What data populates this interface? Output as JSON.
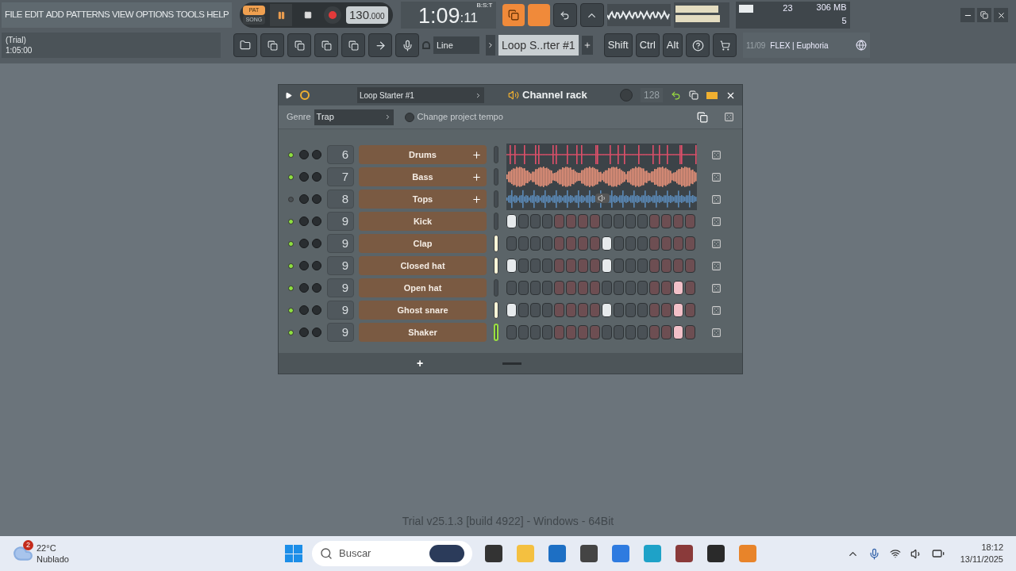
{
  "menu": [
    "FILE",
    "EDIT",
    "ADD",
    "PATTERNS",
    "VIEW",
    "OPTIONS",
    "TOOLS",
    "HELP"
  ],
  "transport": {
    "modes": [
      {
        "label": "PAT",
        "selected": true
      },
      {
        "label": "SONG",
        "selected": false
      }
    ],
    "tempo": "130",
    "tempo_fraction": ".000",
    "time": "1:09",
    "time_sub": ":11",
    "time_unit": "B:S:T"
  },
  "hint_panel": {
    "line_1": "(Trial)",
    "line_2": "1:05:00"
  },
  "snap": "Line",
  "pattern": "Loop S..rter #1",
  "modifier_keys": [
    "Shift",
    "Ctrl",
    "Alt"
  ],
  "monitor": {
    "cpu": "23",
    "memory": "306 MB",
    "polyphony": "5"
  },
  "news": {
    "date": "11/09",
    "text": "FLEX | Euphoria"
  },
  "channel_rack": {
    "loop": "Loop Starter #1",
    "title": "Channel rack",
    "swing": "128",
    "genre_label": "Genre",
    "genre": "Trap",
    "tempo_option": {
      "label": "Change project tempo",
      "checked": false
    },
    "channels": [
      {
        "kind": "audio",
        "number": "6",
        "name": "Drums",
        "active": true,
        "selected": false,
        "focused": false,
        "color": "#e0506a"
      },
      {
        "kind": "audio",
        "number": "7",
        "name": "Bass",
        "active": true,
        "selected": false,
        "focused": false,
        "color": "#e8927a"
      },
      {
        "kind": "audio",
        "number": "8",
        "name": "Tops",
        "active": false,
        "selected": false,
        "focused": false,
        "color": "#5b8ab8"
      },
      {
        "kind": "steps",
        "number": "9",
        "name": "Kick",
        "active": true,
        "selected": false,
        "focused": false,
        "steps": [
          true,
          false,
          false,
          false,
          false,
          false,
          false,
          false,
          false,
          false,
          false,
          false,
          false,
          false,
          false,
          false
        ]
      },
      {
        "kind": "steps",
        "number": "9",
        "name": "Clap",
        "active": true,
        "selected": true,
        "focused": false,
        "steps": [
          false,
          false,
          false,
          false,
          false,
          false,
          false,
          false,
          true,
          false,
          false,
          false,
          false,
          false,
          false,
          false
        ]
      },
      {
        "kind": "steps",
        "number": "9",
        "name": "Closed hat",
        "active": true,
        "selected": true,
        "focused": false,
        "steps": [
          true,
          false,
          false,
          false,
          false,
          false,
          false,
          false,
          true,
          false,
          false,
          false,
          false,
          false,
          false,
          false
        ]
      },
      {
        "kind": "steps",
        "number": "9",
        "name": "Open hat",
        "active": true,
        "selected": false,
        "focused": false,
        "steps": [
          false,
          false,
          false,
          false,
          false,
          false,
          false,
          false,
          false,
          false,
          false,
          false,
          false,
          false,
          true,
          false
        ]
      },
      {
        "kind": "steps",
        "number": "9",
        "name": "Ghost snare",
        "active": true,
        "selected": true,
        "focused": false,
        "steps": [
          true,
          false,
          false,
          false,
          false,
          false,
          false,
          false,
          true,
          false,
          false,
          false,
          false,
          false,
          true,
          false
        ]
      },
      {
        "kind": "steps",
        "number": "9",
        "name": "Shaker",
        "active": true,
        "selected": false,
        "focused": true,
        "steps": [
          false,
          false,
          false,
          false,
          false,
          false,
          false,
          false,
          false,
          false,
          false,
          false,
          false,
          false,
          true,
          false
        ]
      }
    ],
    "add_button": "+"
  },
  "version": "Trial v25.1.3 [build 4922] - Windows - 64Bit",
  "taskbar": {
    "weather_badge": "2",
    "temperature": "22°C",
    "weather": "Nublado",
    "search_placeholder": "Buscar",
    "time": "18:12",
    "date": "13/11/2025"
  }
}
